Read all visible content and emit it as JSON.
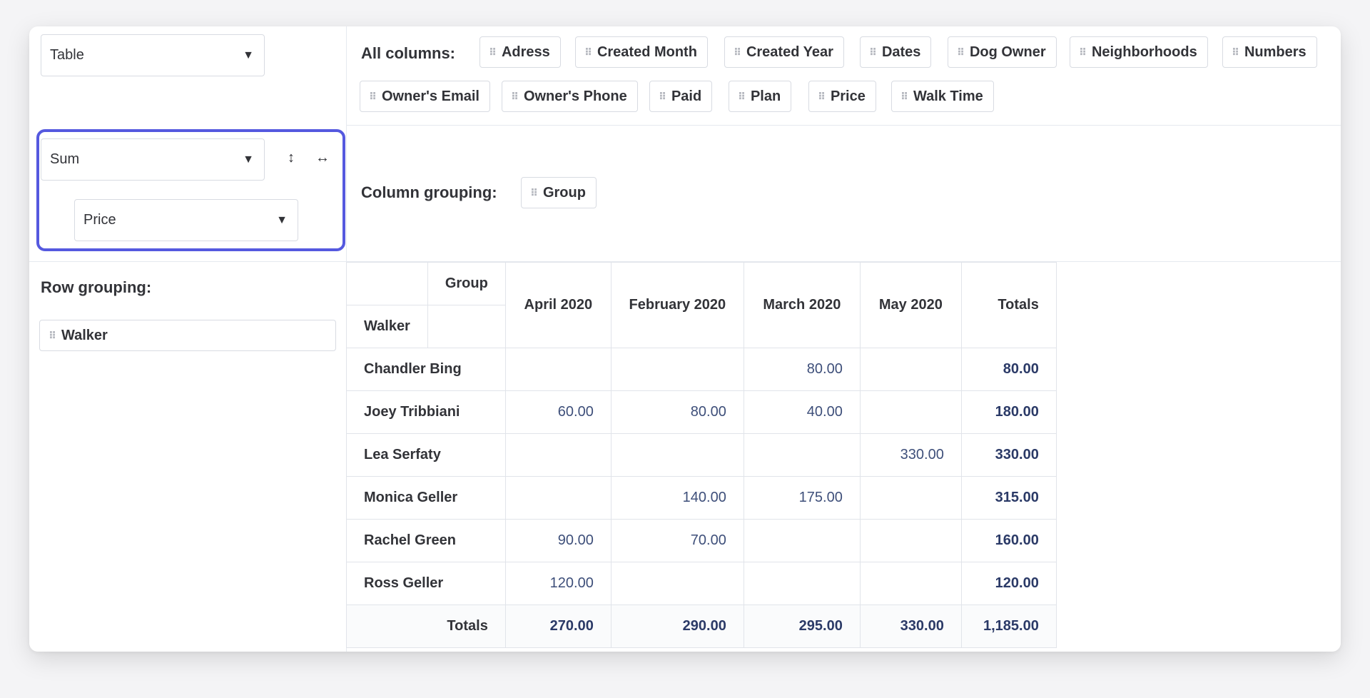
{
  "view_select": {
    "value": "Table"
  },
  "aggregation": {
    "function": "Sum",
    "field": "Price"
  },
  "labels": {
    "all_columns": "All columns:",
    "column_grouping": "Column grouping:",
    "row_grouping": "Row grouping:"
  },
  "all_columns": [
    "Adress",
    "Created Month",
    "Created Year",
    "Dates",
    "Dog Owner",
    "Neighborhoods",
    "Numbers",
    "Owner's Email",
    "Owner's Phone",
    "Paid",
    "Plan",
    "Price",
    "Walk Time"
  ],
  "column_grouping": [
    "Group"
  ],
  "row_grouping": [
    "Walker"
  ],
  "table": {
    "corner_col_label": "Group",
    "corner_row_label": "Walker",
    "columns": [
      "April 2020",
      "February 2020",
      "March 2020",
      "May 2020",
      "Totals"
    ],
    "rows": [
      {
        "name": "Chandler Bing",
        "values": [
          "",
          "",
          "80.00",
          "",
          "80.00"
        ]
      },
      {
        "name": "Joey Tribbiani",
        "values": [
          "60.00",
          "80.00",
          "40.00",
          "",
          "180.00"
        ]
      },
      {
        "name": "Lea Serfaty",
        "values": [
          "",
          "",
          "",
          "330.00",
          "330.00"
        ]
      },
      {
        "name": "Monica Geller",
        "values": [
          "",
          "140.00",
          "175.00",
          "",
          "315.00"
        ]
      },
      {
        "name": "Rachel Green",
        "values": [
          "90.00",
          "70.00",
          "",
          "",
          "160.00"
        ]
      },
      {
        "name": "Ross Geller",
        "values": [
          "120.00",
          "",
          "",
          "",
          "120.00"
        ]
      }
    ],
    "totals_label": "Totals",
    "totals": [
      "270.00",
      "290.00",
      "295.00",
      "330.00",
      "1,185.00"
    ]
  },
  "colors": {
    "accent": "#5559df",
    "value_text": "#3e4f7a",
    "border": "#e1e4ea"
  },
  "icons": {
    "dropdown": "caret-down-icon",
    "swap_vertical": "swap-vertical-icon",
    "swap_horizontal": "swap-horizontal-icon",
    "grip": "drag-handle-icon"
  }
}
